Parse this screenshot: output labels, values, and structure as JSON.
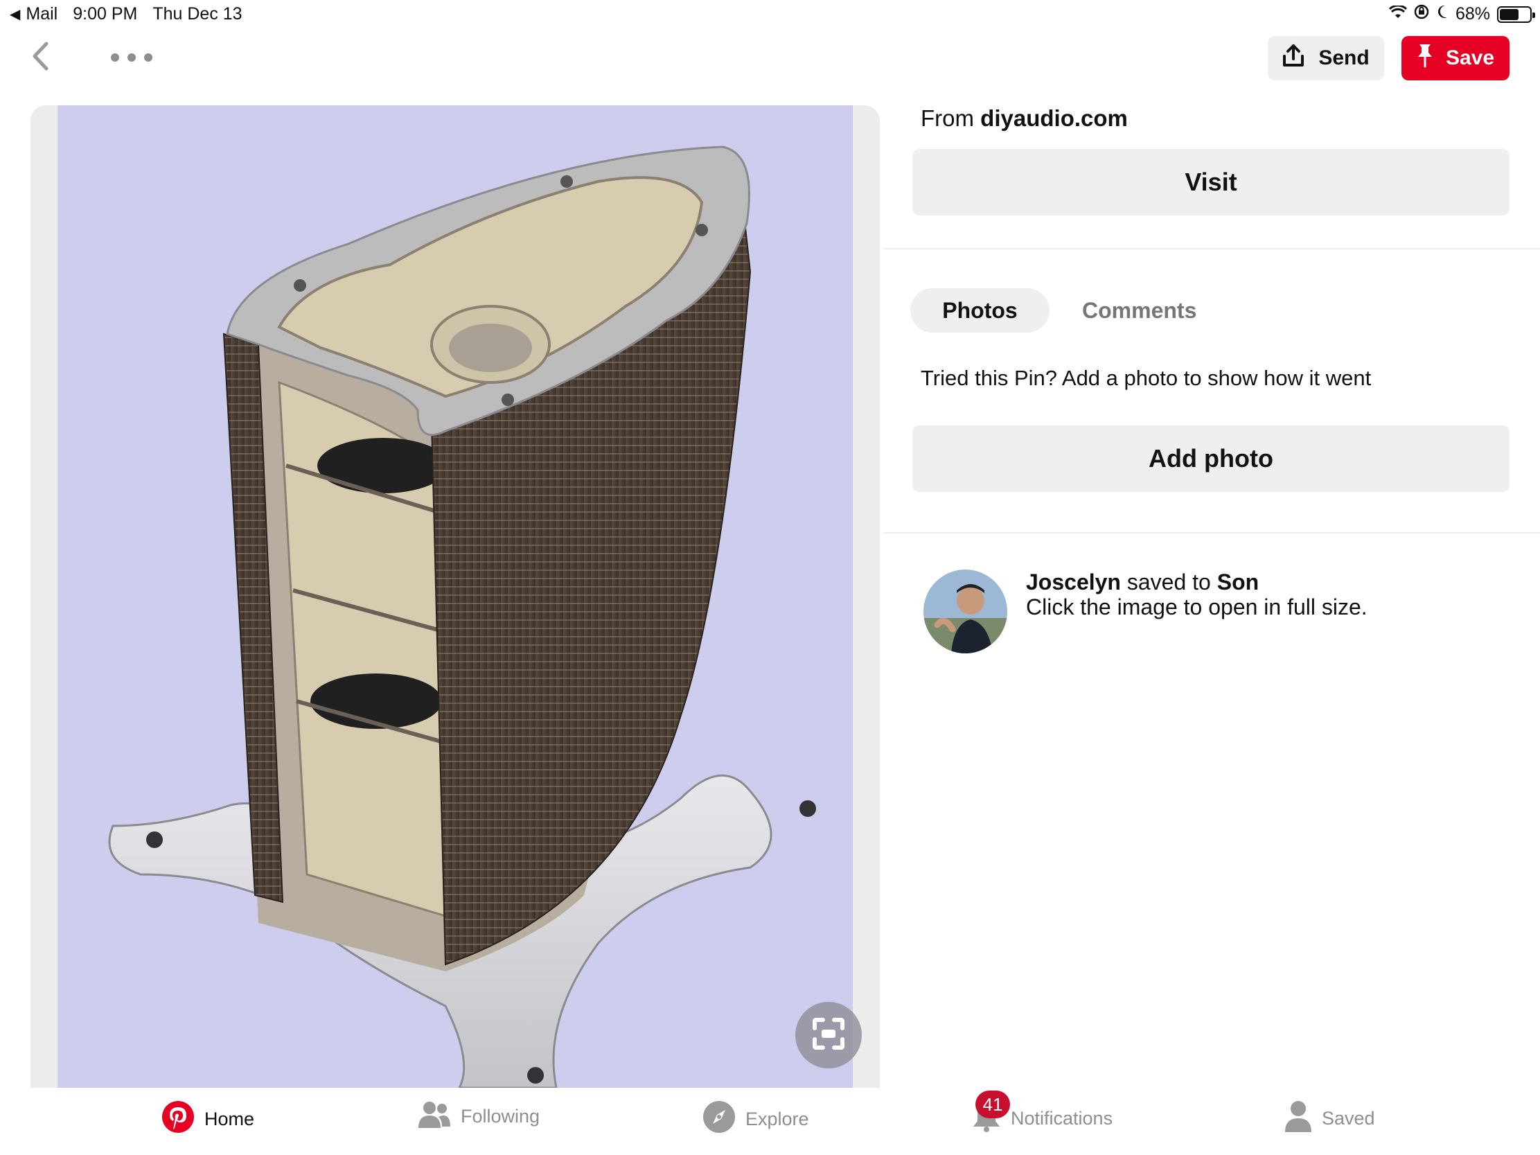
{
  "status_bar": {
    "back_app": "Mail",
    "time": "9:00 PM",
    "date": "Thu Dec 13",
    "battery": "68%",
    "battery_level": 0.68
  },
  "top_nav": {
    "back_icon": "chevron-left-icon",
    "more_icon": "ellipsis-icon",
    "send_label": "Send",
    "save_label": "Save"
  },
  "pin": {
    "from_prefix": "From",
    "from_domain": "diyaudio.com",
    "visit_label": "Visit",
    "image_description_icon": "expand-icon"
  },
  "tabs": {
    "photos": "Photos",
    "comments": "Comments"
  },
  "tried": {
    "text": "Tried this Pin? Add a photo to show how it went",
    "add_photo_label": "Add photo"
  },
  "saved_by": {
    "user": "Joscelyn",
    "middle": "saved to",
    "board": "Son",
    "caption": "Click the image to open in full size."
  },
  "tab_bar": {
    "home": "Home",
    "following": "Following",
    "explore": "Explore",
    "notifications": "Notifications",
    "notifications_badge": "41",
    "saved": "Saved"
  },
  "colors": {
    "brand_red": "#e60023",
    "badge_red": "#c8102e",
    "image_background": "#cdcdee"
  }
}
